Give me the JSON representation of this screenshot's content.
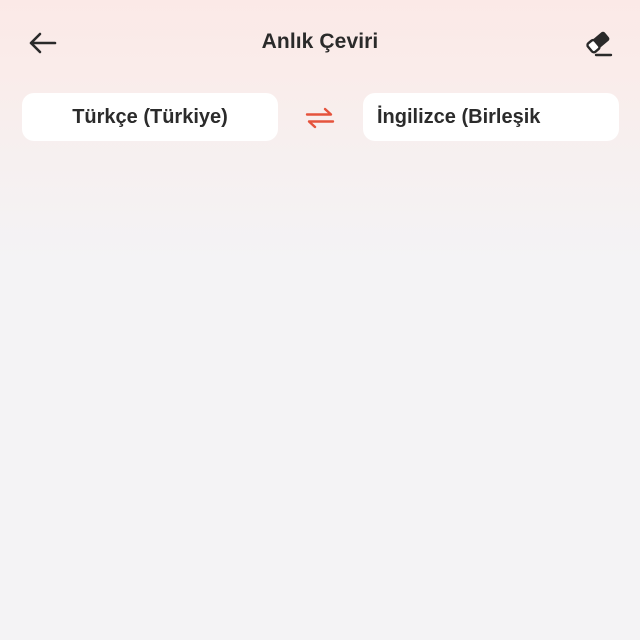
{
  "header": {
    "title": "Anlık Çeviri",
    "back_icon": "arrow-left-icon",
    "eraser_icon": "eraser-icon"
  },
  "languages": {
    "source": "Türkçe (Türkiye)",
    "target": "İngilizce (Birleşik",
    "swap_icon": "swap-arrows-icon"
  },
  "colors": {
    "accent": "#e5533d",
    "text": "#2a2a2a",
    "chip_background": "#ffffff"
  }
}
